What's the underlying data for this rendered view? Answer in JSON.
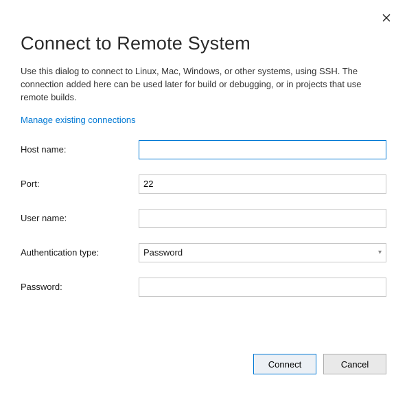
{
  "dialog": {
    "title": "Connect to Remote System",
    "description": "Use this dialog to connect to Linux, Mac, Windows, or other systems, using SSH. The connection added here can be used later for build or debugging, or in projects that use remote builds.",
    "manage_link": "Manage existing connections"
  },
  "form": {
    "host_label": "Host name:",
    "host_value": "",
    "port_label": "Port:",
    "port_value": "22",
    "user_label": "User name:",
    "user_value": "",
    "auth_label": "Authentication type:",
    "auth_value": "Password",
    "password_label": "Password:",
    "password_value": ""
  },
  "buttons": {
    "connect": "Connect",
    "cancel": "Cancel"
  }
}
